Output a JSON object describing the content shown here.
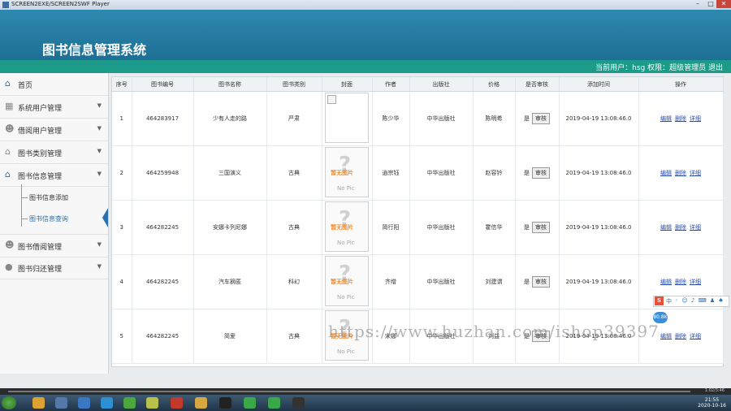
{
  "window": {
    "title": "SCREEN2EXE/SCREEN2SWF Player"
  },
  "header": {
    "system_title": "图书信息管理系统",
    "user_info": "当前用户：hsg 权限：超级管理员 退出"
  },
  "sidebar": {
    "items": [
      {
        "label": "首页",
        "icon": "home-icon"
      },
      {
        "label": "系统用户管理",
        "icon": "grid-icon"
      },
      {
        "label": "借阅用户管理",
        "icon": "users-icon"
      },
      {
        "label": "图书类别管理",
        "icon": "home-icon"
      },
      {
        "label": "图书信息管理",
        "icon": "home-icon"
      },
      {
        "label": "图书借阅管理",
        "icon": "users-icon"
      },
      {
        "label": "图书归还管理",
        "icon": "user-icon"
      }
    ],
    "sub_items": [
      {
        "label": "图书信息添加"
      },
      {
        "label": "图书信息查询"
      }
    ]
  },
  "table": {
    "headers": [
      "序号",
      "图书编号",
      "图书名称",
      "图书类别",
      "封面",
      "作者",
      "出版社",
      "价格",
      "是否审核",
      "添加时间",
      "操作"
    ],
    "audit_button": "审核",
    "actions": [
      "编辑",
      "删除",
      "详细"
    ],
    "no_image_cn": "暂无图片",
    "no_image_en": "No Pic",
    "rows": [
      {
        "no": "1",
        "id": "464283917",
        "name": "少有人走的路",
        "category": "严肃",
        "cover": "broken",
        "author": "陈少华",
        "publisher": "中华出版社",
        "price": "陈明希",
        "audited": "是",
        "time": "2019-04-19 13:08:46.0"
      },
      {
        "no": "2",
        "id": "464259948",
        "name": "三国演义",
        "category": "古典",
        "cover": "nopic",
        "author": "逍宗钰",
        "publisher": "中华出版社",
        "price": "赵容钤",
        "audited": "是",
        "time": "2019-04-19 13:08:46.0"
      },
      {
        "no": "3",
        "id": "464282245",
        "name": "安娜卡列尼娜",
        "category": "古典",
        "cover": "nopic",
        "author": "简行阳",
        "publisher": "中华出版社",
        "price": "霍信华",
        "audited": "是",
        "time": "2019-04-19 13:08:46.0"
      },
      {
        "no": "4",
        "id": "464282245",
        "name": "汽车摘匿",
        "category": "科幻",
        "cover": "nopic",
        "author": "齐缯",
        "publisher": "中华出版社",
        "price": "刘建谓",
        "audited": "是",
        "time": "2019-04-19 13:08:46.0"
      },
      {
        "no": "5",
        "id": "464282245",
        "name": "简爱",
        "category": "古典",
        "cover": "nopic",
        "author": "宋娜",
        "publisher": "中华出版社",
        "price": "刘益",
        "audited": "是",
        "time": "2019-04-19 13:08:46.0"
      }
    ]
  },
  "watermark": "https://www.huzhan.com/ishop39397",
  "ime": {
    "logo": "S",
    "mode": "中",
    "extras": "◦ ☺ ♪ ⌨ ♟ ♠"
  },
  "bubble": "80.8K",
  "player": {
    "time": "1:02/3:46"
  },
  "taskbar": {
    "clock_time": "21:55",
    "clock_date": "2020-10-16"
  }
}
